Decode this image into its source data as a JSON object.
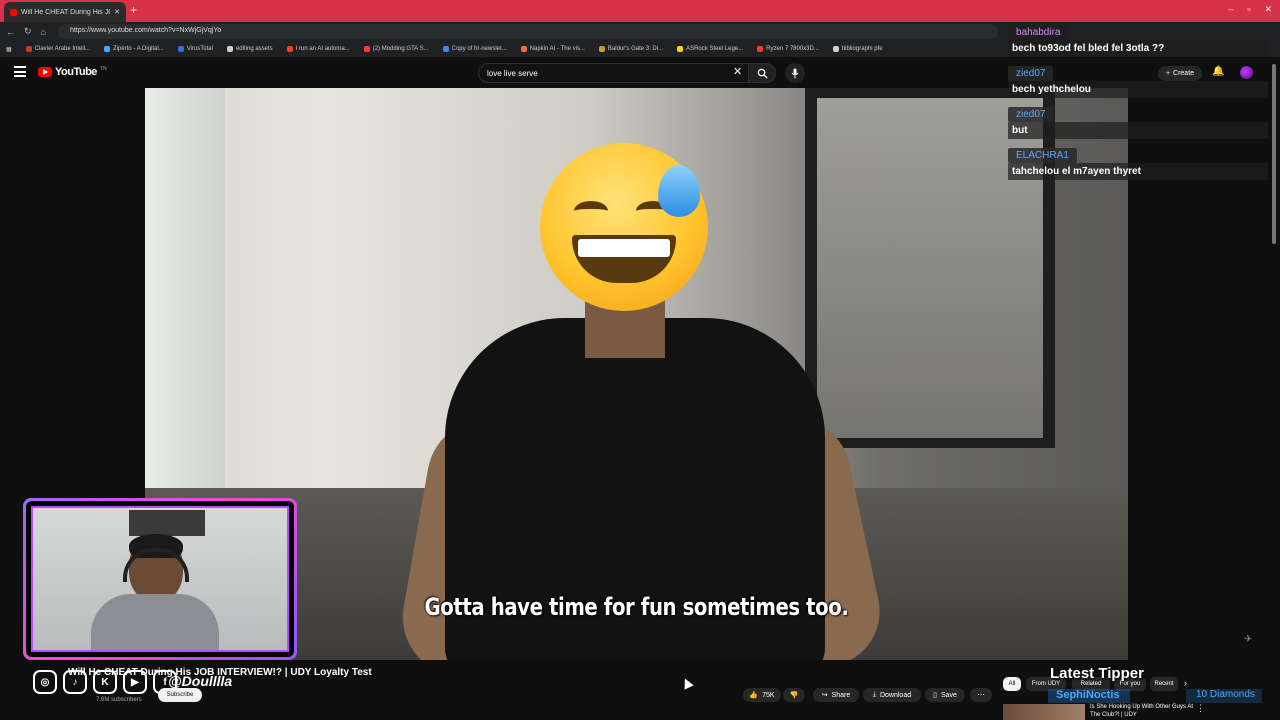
{
  "browser": {
    "tab_title": "Will He CHEAT During His JOB",
    "new_tab": "+",
    "url": "https://www.youtube.com/watch?v=NxWjGjVqjYo",
    "window_controls": [
      "–",
      "▫",
      "✕"
    ],
    "bookmarks": [
      {
        "label": "Clavier Arabe Intell...",
        "color": "#d0342c"
      },
      {
        "label": "Ziperto - A Digital...",
        "color": "#4aa8ff"
      },
      {
        "label": "VirusTotal",
        "color": "#3a6bdc"
      },
      {
        "label": "editing assets",
        "color": "#cccccc"
      },
      {
        "label": "I run an AI automa...",
        "color": "#ff3b30"
      },
      {
        "label": "(2) Modding GTA S...",
        "color": "#ff3b30"
      },
      {
        "label": "Copy of hr-newslet...",
        "color": "#4285f4"
      },
      {
        "label": "Napkin AI - The vis...",
        "color": "#ff6b3d"
      },
      {
        "label": "Baldur's Gate 3: Di...",
        "color": "#c89a3a"
      },
      {
        "label": "ASRock Steel Lege...",
        "color": "#ffd400"
      },
      {
        "label": "Ryzen 7 7800x3D...",
        "color": "#ff3b30"
      },
      {
        "label": "bibliographi pfe",
        "color": "#cccccc"
      }
    ]
  },
  "youtube": {
    "logo_text": "YouTube",
    "logo_tm": "TN",
    "search_value": "love live serve",
    "create_label": "Create"
  },
  "video": {
    "caption": "Gotta have time for fun sometimes too.",
    "title": "Will He CHEAT During His JOB INTERVIEW!? | UDY Loyalty Test",
    "channel_subs": "7.6M subscribers",
    "subscribe_label": "Subscribe",
    "overlay_handle": "@Doulllla"
  },
  "actions": {
    "like_count": "75K",
    "share": "Share",
    "download": "Download",
    "save": "Save"
  },
  "chat": [
    {
      "user": "bahabdira",
      "text": "bech to93od fel bled fel 3otla ??"
    },
    {
      "user": "zied07",
      "text": "bech yethchelou"
    },
    {
      "user": "zied07",
      "text": "but"
    },
    {
      "user": "ELACHRA1",
      "text": "tahchelou el m7ayen thyret"
    }
  ],
  "related": {
    "chips": [
      "All",
      "From UDY",
      "Related",
      "For you",
      "Recent"
    ],
    "first_title": "Is She Hooking Up With Other Guys At The Club?! | UDY"
  },
  "tipper": {
    "heading": "Latest Tipper",
    "name": "SephiNoctis",
    "amount": "10 Diamonds"
  },
  "social_icons": [
    "instagram-icon",
    "tiktok-icon",
    "kick-icon",
    "youtube-icon",
    "facebook-icon"
  ],
  "colors": {
    "tab_bar": "#d9314a",
    "youtube_red": "#ff0000",
    "webcam_border": "#b44bff",
    "chat_user": "#5aa9ff"
  }
}
